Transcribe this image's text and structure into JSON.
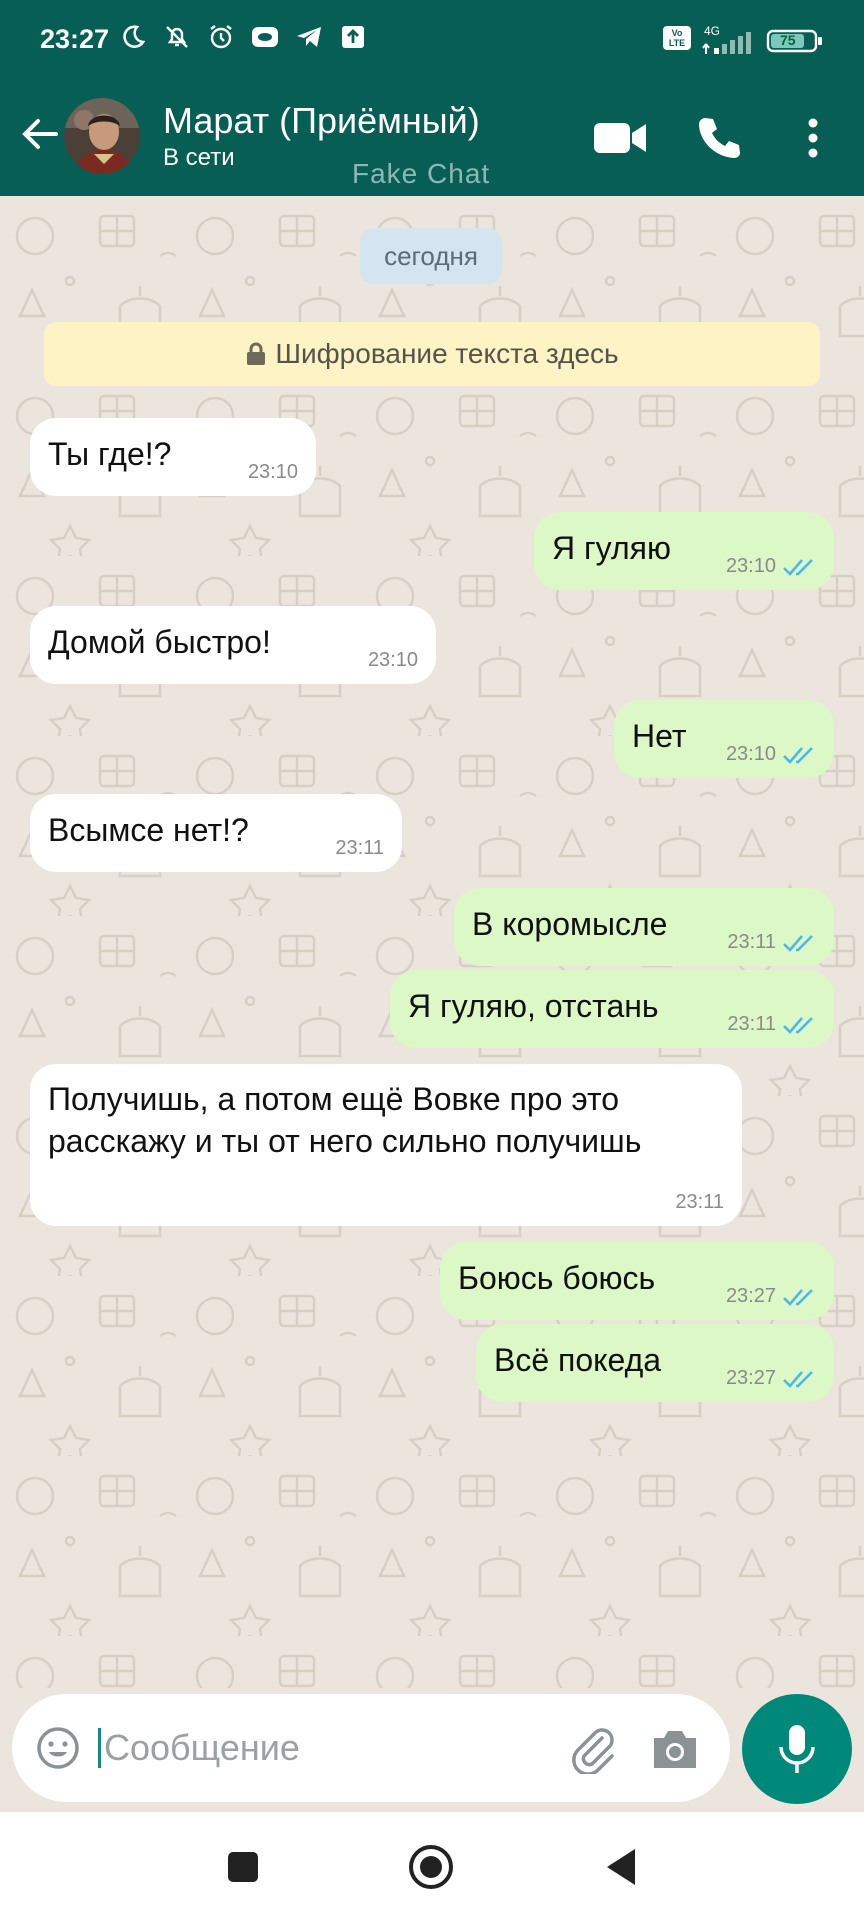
{
  "status_bar": {
    "time": "23:27",
    "network": "4G",
    "volte": "Vo LTE",
    "battery": "75",
    "icons_left": [
      "moon-icon",
      "bell-off-icon",
      "alarm-icon",
      "app-icon",
      "telegram-icon",
      "upload-icon"
    ]
  },
  "header": {
    "contact_name": "Марат (Приёмный)",
    "status": "В сети",
    "watermark": "Fake Chat"
  },
  "chat": {
    "date_chip": "сегодня",
    "encryption_banner": "Шифрование текста здесь",
    "messages": [
      {
        "dir": "in",
        "text": "Ты где!?",
        "time": "23:10"
      },
      {
        "dir": "out",
        "text": "Я гуляю",
        "time": "23:10",
        "read": true
      },
      {
        "dir": "in",
        "text": "Домой быстро!",
        "time": "23:10"
      },
      {
        "dir": "out",
        "text": "Нет",
        "time": "23:10",
        "read": true
      },
      {
        "dir": "in",
        "text": "Всымсе нет!?",
        "time": "23:11"
      },
      {
        "dir": "out",
        "text": "В коромысле",
        "time": "23:11",
        "read": true
      },
      {
        "dir": "out",
        "text": "Я гуляю, отстань",
        "time": "23:11",
        "read": true
      },
      {
        "dir": "in",
        "text": "Получишь, а потом ещё Вовке про это расскажу и ты от него сильно получишь",
        "time": "23:11"
      },
      {
        "dir": "out",
        "text": "Боюсь боюсь",
        "time": "23:27",
        "read": true
      },
      {
        "dir": "out",
        "text": "Всё покеда",
        "time": "23:27",
        "read": true
      }
    ]
  },
  "input": {
    "placeholder": "Сообщение",
    "value": ""
  },
  "colors": {
    "header": "#075e54",
    "chat_bg": "#ece5dd",
    "incoming": "#ffffff",
    "outgoing": "#dcf8c6",
    "accent": "#00897b",
    "read_ticks": "#4fb6ec"
  }
}
